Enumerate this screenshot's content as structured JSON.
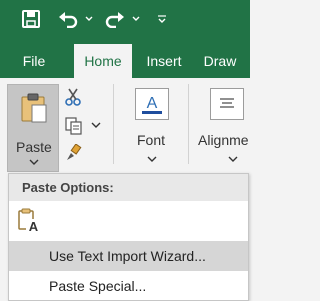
{
  "quick_access": {
    "save_icon": "save-icon",
    "undo_icon": "undo-icon",
    "redo_icon": "redo-icon",
    "customize_icon": "chevron-down-icon"
  },
  "tabs": [
    {
      "label": "File",
      "active": false
    },
    {
      "label": "Home",
      "active": true
    },
    {
      "label": "Insert",
      "active": false
    },
    {
      "label": "Draw",
      "active": false
    }
  ],
  "ribbon": {
    "paste_label": "Paste",
    "font_label": "Font",
    "alignment_label": "Alignme",
    "cut_icon": "scissors-icon",
    "copy_icon": "copy-icon",
    "format_painter_icon": "paintbrush-icon"
  },
  "paste_menu": {
    "header": "Paste Options:",
    "keep_text_only_icon": "paste-text-only-icon",
    "items": [
      {
        "label": "Use Text Import Wizard...",
        "hover": true
      },
      {
        "label": "Paste Special...",
        "hover": false
      }
    ]
  },
  "colors": {
    "accent": "#217346",
    "ribbon_bg": "#f3f3f3",
    "paste_pressed": "#c5c5c5",
    "menu_hover": "#d6d6d6"
  }
}
